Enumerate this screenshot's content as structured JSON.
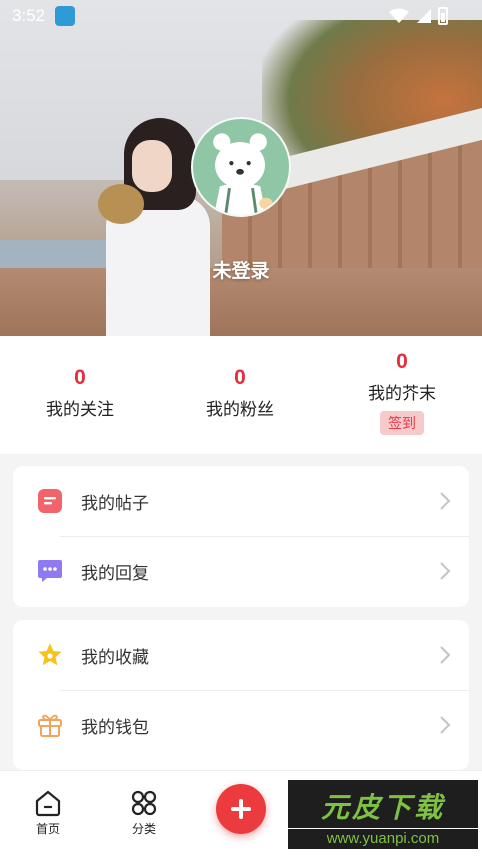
{
  "status_bar": {
    "time": "3:52",
    "icons": [
      "app-notification-icon",
      "wifi-icon",
      "signal-icon",
      "battery-icon"
    ]
  },
  "profile": {
    "username": "未登录",
    "avatar": "bear-avatar"
  },
  "stats": {
    "follow": {
      "value": "0",
      "label": "我的关注"
    },
    "fans": {
      "value": "0",
      "label": "我的粉丝"
    },
    "coins": {
      "value": "0",
      "label": "我的芥末",
      "checkin_label": "签到"
    }
  },
  "menu": {
    "posts": "我的帖子",
    "replies": "我的回复",
    "favorites": "我的收藏",
    "wallet": "我的钱包"
  },
  "tabbar": {
    "home": "首页",
    "category": "分类"
  },
  "watermark": {
    "brand": "元皮下载",
    "url": "www.yuanpi.com"
  },
  "colors": {
    "accent": "#e52e3c",
    "checkin_bg": "#f6c9cb",
    "add_button": "#ec3b3f",
    "posts_icon": "#f0646a",
    "replies_icon": "#8f7af4",
    "favorites_icon": "#f6c21c",
    "wallet_icon": "#f0a45d"
  }
}
